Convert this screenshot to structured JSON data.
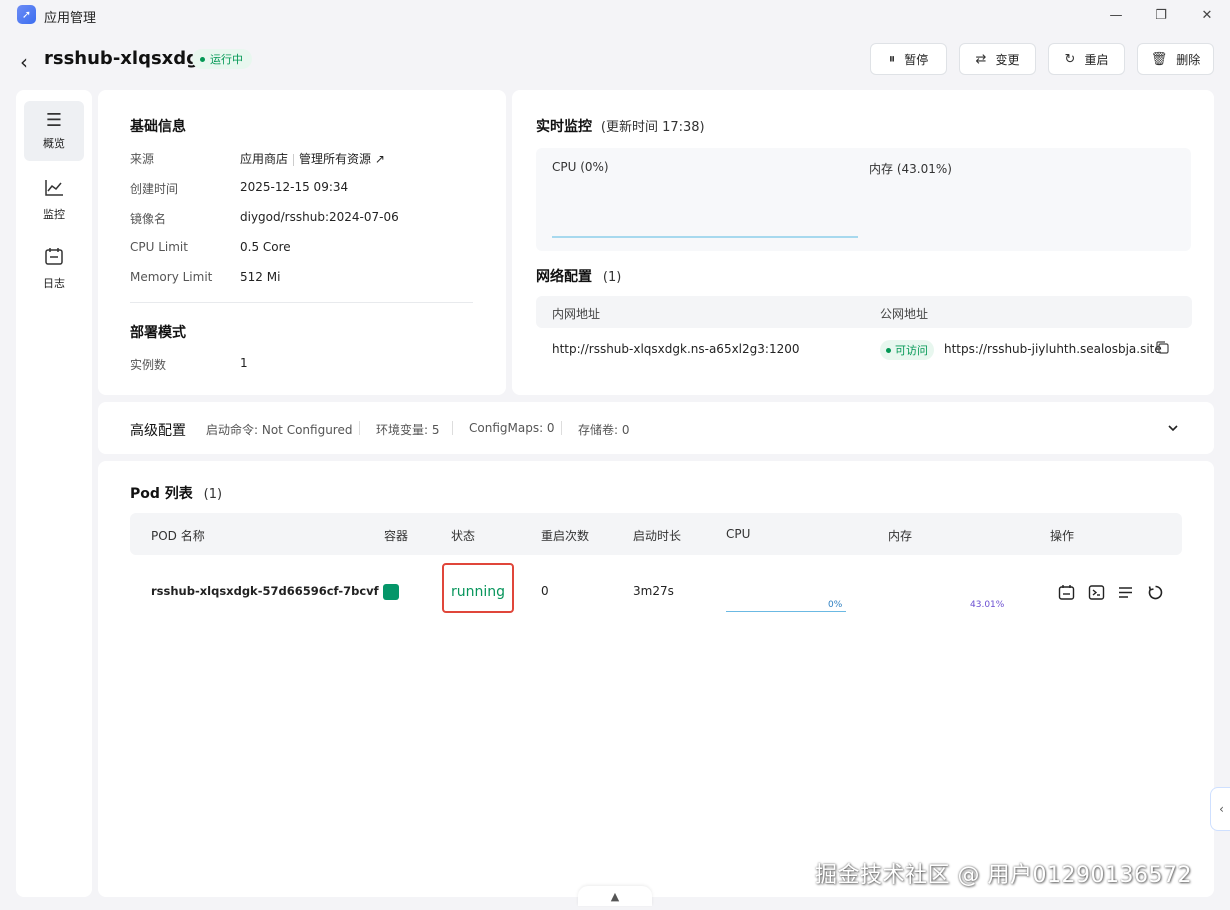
{
  "window": {
    "title": "应用管理",
    "controls": {
      "minimize": "—",
      "restore": "❐",
      "close": "✕"
    }
  },
  "header": {
    "app_name": "rsshub-xlqsxdgk",
    "status": "运行中",
    "buttons": {
      "pause": "暂停",
      "change": "变更",
      "restart": "重启",
      "delete": "删除"
    }
  },
  "sidebar": {
    "items": [
      {
        "label": "概览",
        "icon": "server-icon",
        "glyph": "☰"
      },
      {
        "label": "监控",
        "icon": "chart-icon",
        "glyph": "📈"
      },
      {
        "label": "日志",
        "icon": "calendar-icon",
        "glyph": "🗓"
      }
    ]
  },
  "basic_info": {
    "title": "基础信息",
    "source_label": "来源",
    "source_value": "应用商店",
    "source_link": "管理所有资源 ↗",
    "created_label": "创建时间",
    "created_value": "2025-12-15 09:34",
    "image_label": "镜像名",
    "image_value": "diygod/rsshub:2024-07-06",
    "cpu_label": "CPU Limit",
    "cpu_value": "0.5 Core",
    "mem_label": "Memory Limit",
    "mem_value": "512 Mi",
    "deploy_title": "部署模式",
    "instances_label": "实例数",
    "instances_value": "1"
  },
  "monitor": {
    "title": "实时监控",
    "update_text": "(更新时间  17:38)",
    "cpu_label": "CPU  (0%)",
    "mem_label": "内存  (43.01%)"
  },
  "network": {
    "title": "网络配置",
    "count": "(1)",
    "col_internal": "内网地址",
    "col_public": "公网地址",
    "internal_value": "http://rsshub-xlqsxdgk.ns-a65xl2g3:1200",
    "access_badge": "可访问",
    "public_value": "https://rsshub-jiyluhth.sealosbja.site"
  },
  "advanced": {
    "title": "高级配置",
    "start_cmd": "启动命令: Not Configured",
    "env": "环境变量: 5",
    "configmaps": "ConfigMaps: 0",
    "storage": "存储卷: 0"
  },
  "pods": {
    "title": "Pod 列表",
    "count": "(1)",
    "columns": {
      "name": "POD 名称",
      "container": "容器",
      "status": "状态",
      "restarts": "重启次数",
      "uptime": "启动时长",
      "cpu": "CPU",
      "memory": "内存",
      "actions": "操作"
    },
    "rows": [
      {
        "name": "rsshub-xlqsxdgk-57d66596cf-7bcvf",
        "status": "running",
        "restarts": "0",
        "uptime": "3m27s",
        "cpu_pct": "0%",
        "mem_pct": "43.01%"
      }
    ]
  },
  "watermark": "掘金技术社区 @ 用户01290136572",
  "colors": {
    "accent_green": "#039855",
    "running_border": "#e0463a",
    "cpu_bar": "#6bb9e3",
    "mem_text": "#6b4fd1"
  }
}
